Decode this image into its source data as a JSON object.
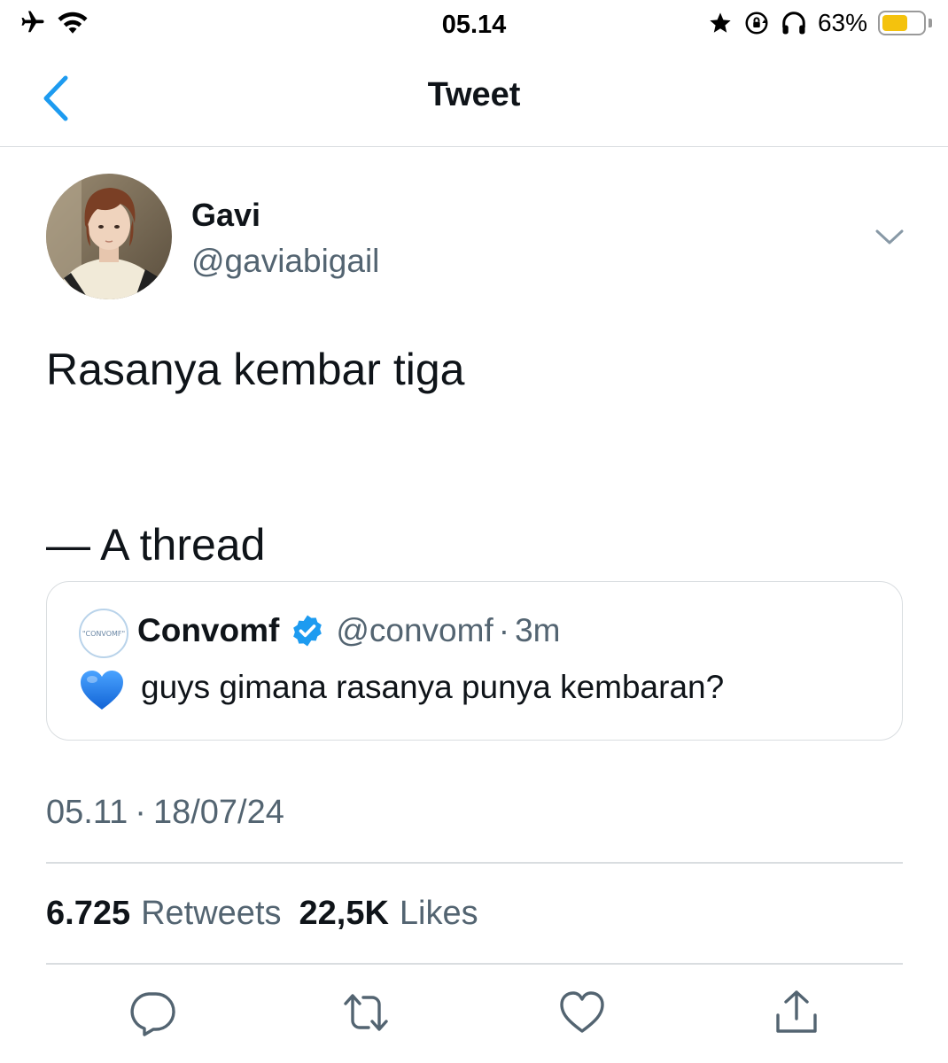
{
  "status_bar": {
    "time": "05.14",
    "battery_percent": "63%",
    "battery_level": 0.63,
    "icons": [
      "airplane-icon",
      "wifi-icon",
      "star-icon",
      "rotation-lock-icon",
      "headphones-icon",
      "battery-icon"
    ]
  },
  "nav": {
    "title": "Tweet",
    "back_icon": "chevron-left-icon"
  },
  "tweet": {
    "author_name": "Gavi",
    "author_handle": "@gaviabigail",
    "text": "Rasanya kembar tiga\n\n\n— A thread",
    "timestamp_time": "05.11",
    "timestamp_sep": "·",
    "timestamp_date": "18/07/24"
  },
  "quote": {
    "avatar_text": "\"CONVOMF\"",
    "name": "Convomf",
    "handle": "@convomf",
    "sep": "·",
    "time": "3m",
    "text": "guys gimana rasanya punya kembaran?"
  },
  "stats": {
    "retweets_value": "6.725",
    "retweets_label": "Retweets",
    "likes_value": "22,5K",
    "likes_label": "Likes"
  },
  "colors": {
    "accent": "#1d9bf0",
    "text_primary": "#0f1419",
    "text_secondary": "#536471",
    "divider": "#d9dde0",
    "battery": "#f4c20d",
    "heart_emoji": "#1a73e8"
  },
  "actions": [
    "reply-icon",
    "retweet-icon",
    "like-icon",
    "share-icon"
  ]
}
